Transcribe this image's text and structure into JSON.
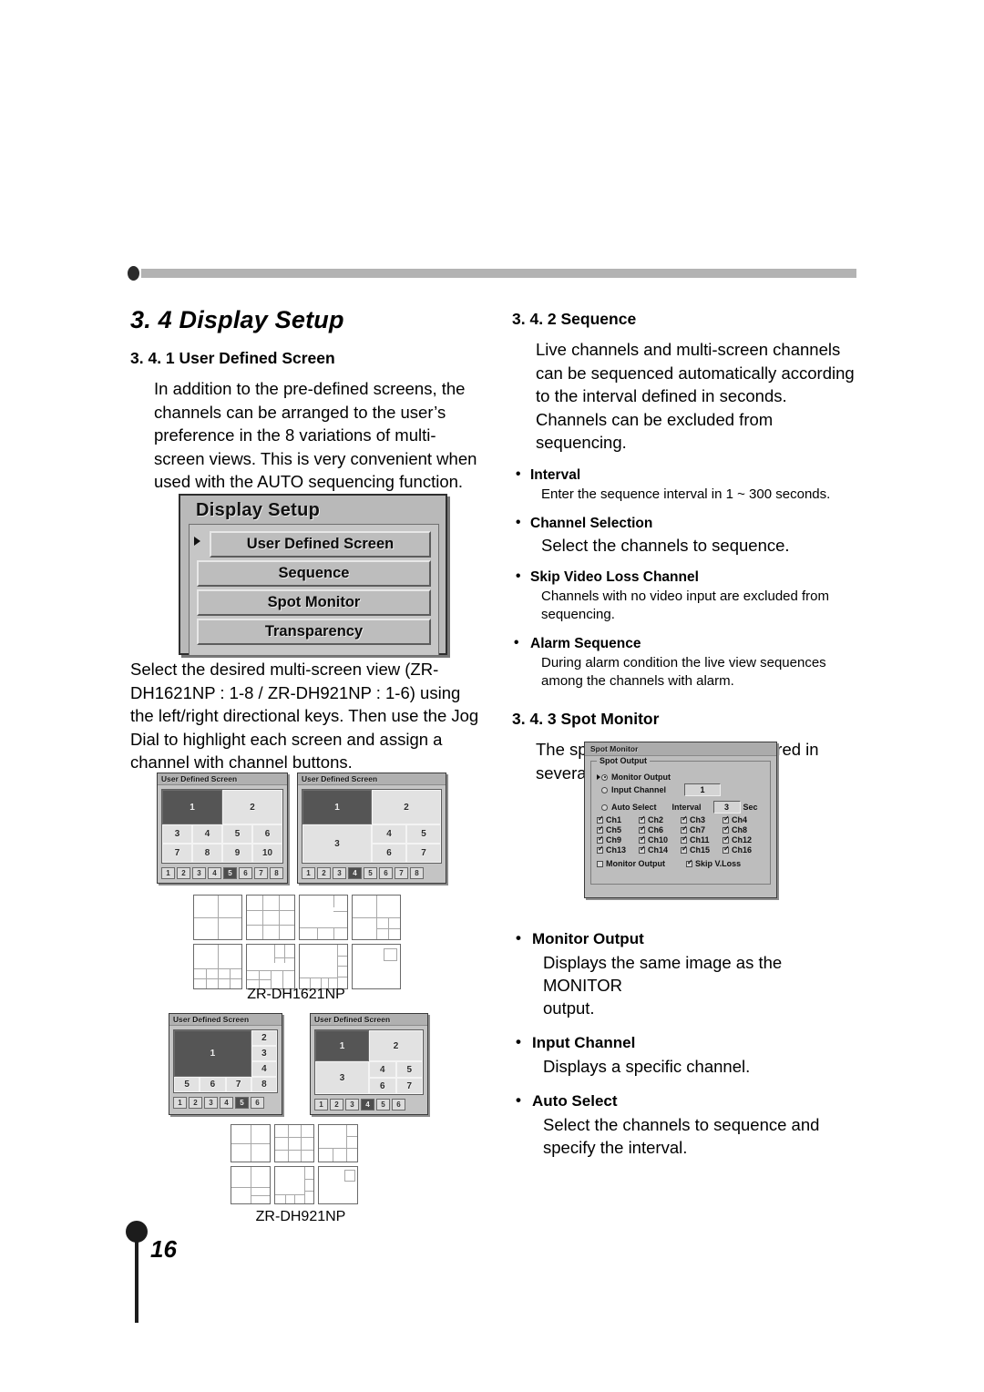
{
  "page": {
    "number": "16"
  },
  "left_column": {
    "section_title": "3. 4 Display Setup",
    "sub1_title": "3. 4. 1 User Defined Screen",
    "sub1_para": "In addition to the pre-defined screens, the channels can be arranged to the user’s preference in the 8 variations of multi-screen views. This is very convenient when used with the AUTO sequencing function.",
    "sub1_para2": "Select the desired multi-screen view (ZR-DH1621NP : 1-8 / ZR-DH921NP : 1-6) using the left/right directional keys. Then use the Jog Dial to highlight each screen and assign a channel with channel buttons."
  },
  "display_setup_menu": {
    "title": "Display Setup",
    "items": [
      {
        "label": "User Defined Screen",
        "selected": true
      },
      {
        "label": "Sequence",
        "selected": false
      },
      {
        "label": "Spot Monitor",
        "selected": false
      },
      {
        "label": "Transparency",
        "selected": false
      }
    ]
  },
  "uds_panels": [
    {
      "title": "User Defined Screen",
      "cells": [
        "1",
        "2",
        "3",
        "4",
        "5",
        "6",
        "7",
        "8",
        "9",
        "10"
      ],
      "buttons": [
        "1",
        "2",
        "3",
        "4",
        "5",
        "6",
        "7",
        "8"
      ],
      "active_button": "5"
    },
    {
      "title": "User Defined Screen",
      "cells": [
        "1",
        "2",
        "3",
        "4",
        "5",
        "6",
        "7"
      ],
      "buttons": [
        "1",
        "2",
        "3",
        "4",
        "5",
        "6",
        "7",
        "8"
      ],
      "active_button": "4"
    },
    {
      "title": "User Defined Screen",
      "cells": [
        "1",
        "2",
        "3",
        "4",
        "5",
        "6",
        "7",
        "8"
      ],
      "buttons": [
        "1",
        "2",
        "3",
        "4",
        "5",
        "6"
      ],
      "active_button": "5"
    },
    {
      "title": "User Defined Screen",
      "cells": [
        "1",
        "2",
        "3",
        "4",
        "5",
        "6",
        "7"
      ],
      "buttons": [
        "1",
        "2",
        "3",
        "4",
        "5",
        "6"
      ],
      "active_button": "4"
    }
  ],
  "thumb_captions": {
    "model_1621": "ZR-DH1621NP",
    "model_921": "ZR-DH921NP"
  },
  "right_column": {
    "sub2_title": "3. 4. 2 Sequence",
    "sub2_para": "Live channels and multi-screen channels can be sequenced automatically according to the interval defined in seconds. Channels can be excluded from sequencing.",
    "bullets_sequence": [
      {
        "head": "Interval",
        "body": "Enter the sequence interval in 1 ~ 300 seconds."
      },
      {
        "head": "Channel Selection",
        "body": "Select the channels to sequence."
      },
      {
        "head": "Skip Video Loss Channel",
        "body": "Channels with no video input are excluded from sequencing."
      },
      {
        "head": "Alarm Sequence",
        "body": "During alarm condition the live view sequences among the channels with alarm."
      }
    ],
    "sub3_title": "3. 4. 3 Spot Monitor",
    "sub3_para": "The spot monitor can be configured in several ways.",
    "bullets_spot": [
      {
        "head": "Monitor Output",
        "body": "Displays the same image as the MONITOR\noutput."
      },
      {
        "head": "Input Channel",
        "body": "Displays a specific channel."
      },
      {
        "head": "Auto Select",
        "body": "Select the channels to sequence and specify the interval."
      }
    ]
  },
  "spot_dialog": {
    "title": "Spot Monitor",
    "group_legend": "Spot Output",
    "monitor_output_radio": {
      "label": "Monitor Output",
      "selected": true
    },
    "input_channel_radio": {
      "label": "Input Channel",
      "selected": false,
      "value": "1"
    },
    "auto_select_radio": {
      "label": "Auto Select",
      "selected": false
    },
    "interval_label": "Interval",
    "interval_value": "3",
    "interval_unit": "Sec",
    "channels": [
      {
        "label": "Ch1",
        "checked": true
      },
      {
        "label": "Ch2",
        "checked": true
      },
      {
        "label": "Ch3",
        "checked": true
      },
      {
        "label": "Ch4",
        "checked": true
      },
      {
        "label": "Ch5",
        "checked": true
      },
      {
        "label": "Ch6",
        "checked": true
      },
      {
        "label": "Ch7",
        "checked": true
      },
      {
        "label": "Ch8",
        "checked": true
      },
      {
        "label": "Ch9",
        "checked": true
      },
      {
        "label": "Ch10",
        "checked": true
      },
      {
        "label": "Ch11",
        "checked": true
      },
      {
        "label": "Ch12",
        "checked": true
      },
      {
        "label": "Ch13",
        "checked": true
      },
      {
        "label": "Ch14",
        "checked": true
      },
      {
        "label": "Ch15",
        "checked": true
      },
      {
        "label": "Ch16",
        "checked": true
      }
    ],
    "footer_monitor_output": {
      "label": "Monitor Output",
      "checked": false
    },
    "footer_skip_vloss": {
      "label": "Skip V.Loss",
      "checked": true
    }
  }
}
